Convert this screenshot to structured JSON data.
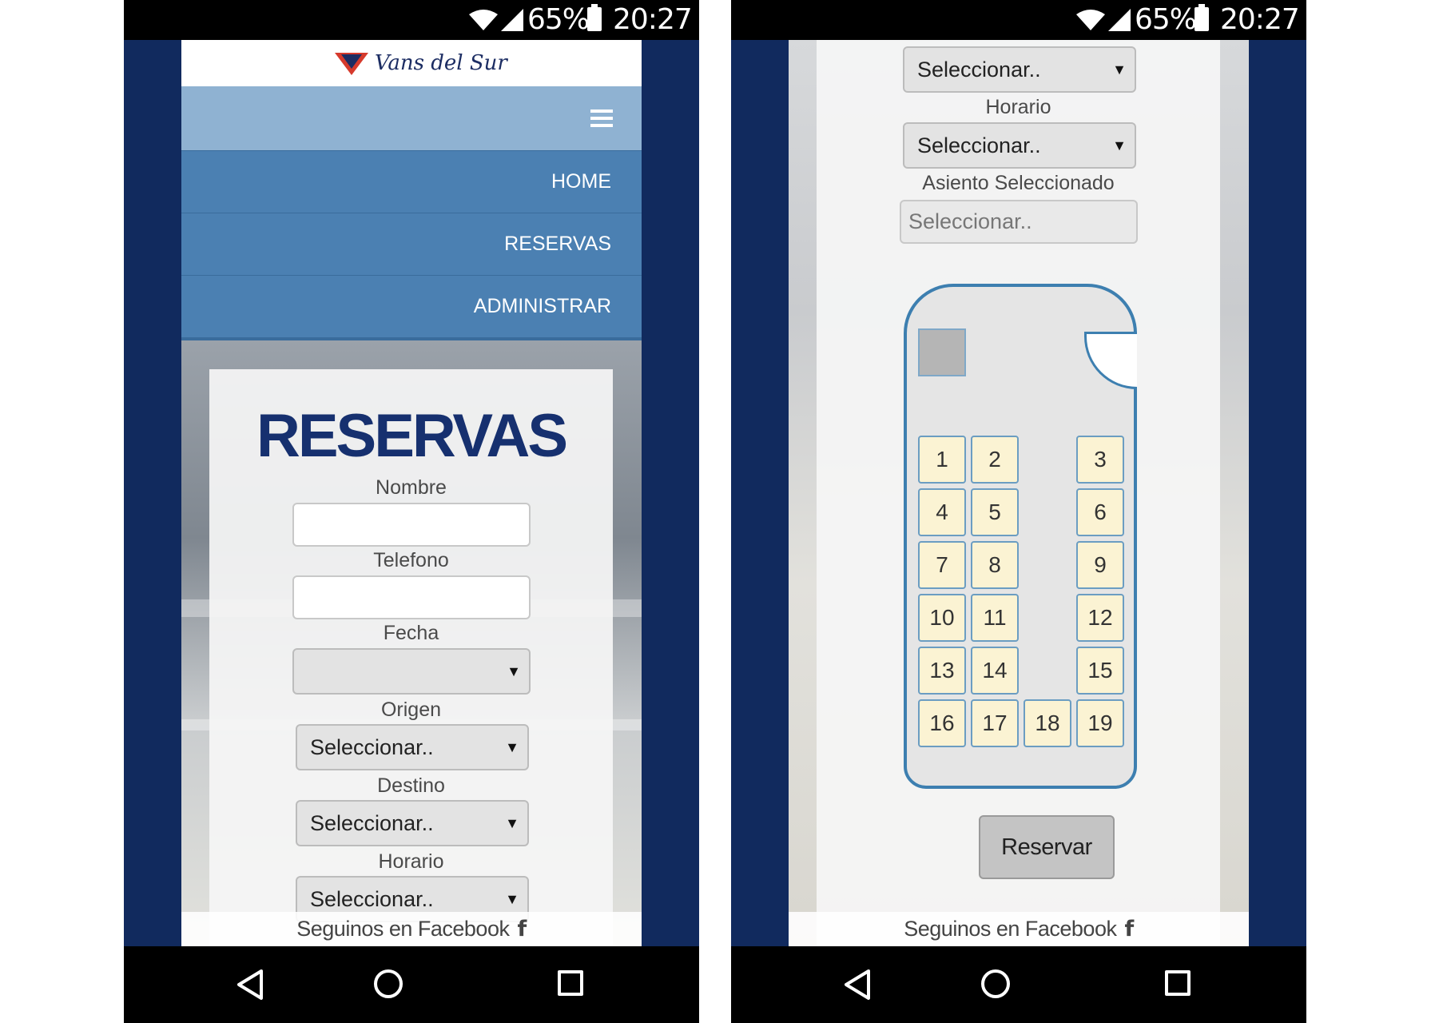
{
  "status_bar": {
    "battery": "65%",
    "time": "20:27"
  },
  "brand": {
    "name": "Vans del Sur"
  },
  "menu": {
    "items": [
      {
        "label": "HOME"
      },
      {
        "label": "RESERVAS"
      },
      {
        "label": "ADMINISTRAR"
      }
    ]
  },
  "form": {
    "title": "RESERVAS",
    "nombre_label": "Nombre",
    "telefono_label": "Telefono",
    "fecha_label": "Fecha",
    "origen_label": "Origen",
    "destino_label": "Destino",
    "horario_label": "Horario",
    "asiento_label": "Asiento Seleccionado",
    "select_placeholder": "Seleccionar..",
    "asiento_placeholder": "Seleccionar..",
    "reserve_button": "Reservar"
  },
  "seats": [
    "1",
    "2",
    "3",
    "4",
    "5",
    "6",
    "7",
    "8",
    "9",
    "10",
    "11",
    "12",
    "13",
    "14",
    "15",
    "16",
    "17",
    "18",
    "19"
  ],
  "footer": {
    "text": "Seguinos en Facebook",
    "icon": "facebook-icon"
  },
  "colors": {
    "frame": "#112a5e",
    "menu_bar": "#8fb2d2",
    "menu_item": "#4b80b2",
    "title": "#16306f",
    "bus_outline": "#3d7fb0",
    "seat_fill": "#fbf3d3"
  }
}
